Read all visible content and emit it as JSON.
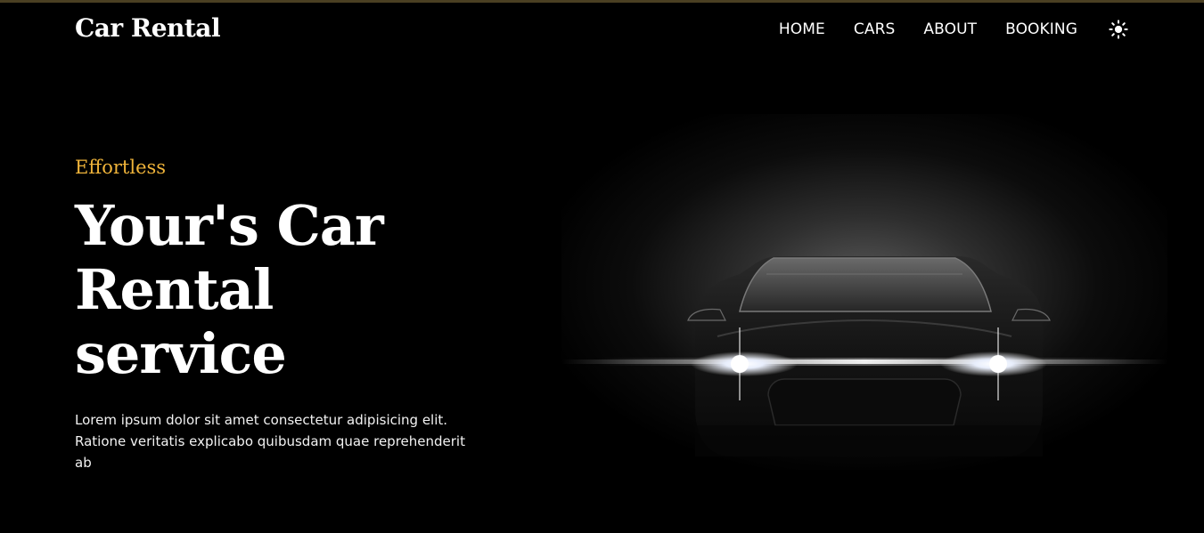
{
  "header": {
    "logo": "Car Rental",
    "nav": [
      {
        "label": "HOME"
      },
      {
        "label": "CARS"
      },
      {
        "label": "ABOUT"
      },
      {
        "label": "BOOKING"
      }
    ],
    "theme_toggle_icon": "sun-icon"
  },
  "hero": {
    "eyebrow": "Effortless",
    "headline": "Your's Car Rental service",
    "description": "Lorem ipsum dolor sit amet consectetur adipisicing elit. Ratione veritatis explicabo quibusdam quae reprehenderit ab",
    "image_icon": "car-headlights-image"
  },
  "colors": {
    "background": "#000000",
    "accent": "#f0b43a",
    "text": "#ffffff",
    "top_border": "#4a3f22"
  }
}
